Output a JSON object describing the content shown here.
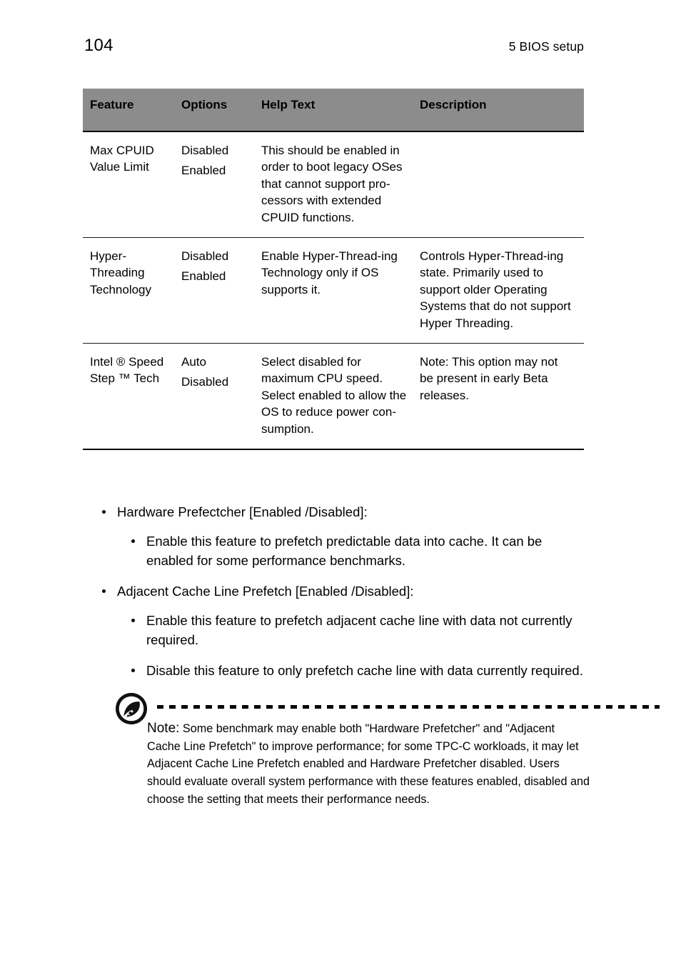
{
  "header": {
    "page_number": "104",
    "chapter": "5 BIOS setup"
  },
  "table": {
    "columns": [
      "Feature",
      "Options",
      "Help Text",
      "Description"
    ],
    "header_bg": "#8c8c8c",
    "rows": [
      {
        "feature": "Max CPUID Value Limit",
        "options": [
          "Disabled",
          "Enabled"
        ],
        "help_text": "This should be enabled in order to boot legacy OSes that cannot support pro-cessors with extended CPUID functions.",
        "description": ""
      },
      {
        "feature": "Hyper-Threading Technology",
        "options": [
          "Disabled",
          "Enabled"
        ],
        "help_text_1": "Enable Hyper-Thread-ing",
        "help_text_2": "Technology only if OS supports it.",
        "description": "Controls Hyper-Thread-ing state.  Primarily used to support older Operating Systems that do not support Hyper Threading."
      },
      {
        "feature": "Intel ® Speed Step ™ Tech",
        "options": [
          "Auto",
          "Disabled"
        ],
        "help_text": "Select disabled for maximum CPU speed. Select enabled to allow the OS to reduce power con-sumption.",
        "description": "Note:  This option may not be present in early Beta releases."
      }
    ]
  },
  "bullets": [
    {
      "level": 1,
      "text": "Hardware Prefectcher [Enabled /Disabled]:"
    },
    {
      "level": 2,
      "text": "Enable this feature to prefetch predictable data into cache. It can be enabled for some performance benchmarks."
    },
    {
      "level": 1,
      "text": "Adjacent Cache Line Prefetch [Enabled /Disabled]:"
    },
    {
      "level": 2,
      "text": "Enable this feature to prefetch adjacent cache line with data not currently required."
    },
    {
      "level": 2,
      "text": "Disable this feature to only prefetch cache line with data currently required."
    }
  ],
  "note": {
    "icon": "acer-note-icon",
    "label": "Note:",
    "body": " Some benchmark may enable both \"Hardware Prefetcher\" and \"Adjacent Cache Line Prefetch\" to improve performance; for some TPC-C workloads, it may let Adjacent Cache Line Prefetch enabled and Hardware Prefetcher disabled. Users should evaluate overall system performance with these features enabled, disabled and choose the setting that meets their performance needs."
  }
}
